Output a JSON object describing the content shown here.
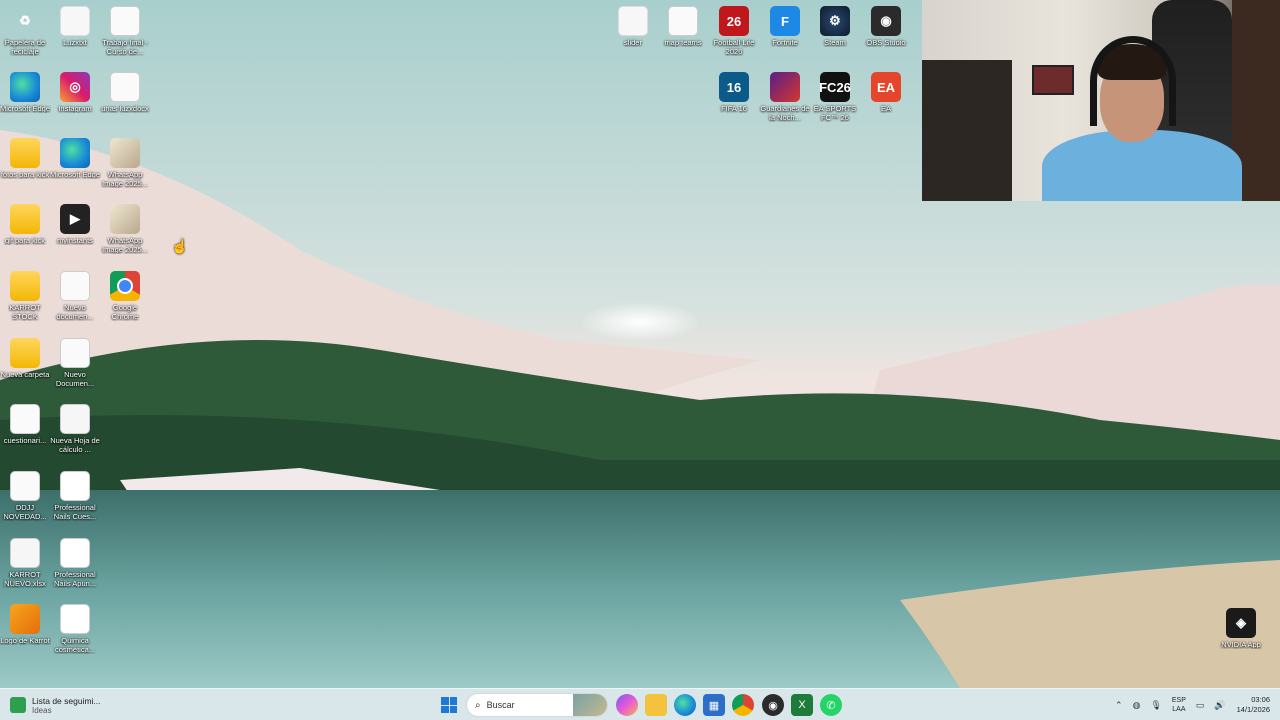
{
  "desktop_icons_left": [
    {
      "label": "Papelera de reciclaje",
      "icon": "recycle-bin-icon"
    },
    {
      "label": "Luzxtxt",
      "icon": "text-file-icon"
    },
    {
      "label": "Trabajo final - Curso de...",
      "icon": "document-icon"
    },
    {
      "label": "Microsoft Edge",
      "icon": "edge-icon"
    },
    {
      "label": "Instagram",
      "icon": "instagram-icon"
    },
    {
      "label": "unas luzxdocx",
      "icon": "document-icon"
    },
    {
      "label": "fotos para kick",
      "icon": "folder-icon"
    },
    {
      "label": "Microsoft Edge",
      "icon": "edge-icon"
    },
    {
      "label": "WhatsApp Image 2025...",
      "icon": "image-icon"
    },
    {
      "label": "gif para kick",
      "icon": "folder-icon"
    },
    {
      "label": "myinstants",
      "icon": "media-icon"
    },
    {
      "label": "WhatsApp Image 2025...",
      "icon": "image-icon"
    },
    {
      "label": "KARROT STOCK",
      "icon": "folder-icon"
    },
    {
      "label": "Nuevo documen...",
      "icon": "document-icon"
    },
    {
      "label": "Google Chrome",
      "icon": "chrome-icon"
    },
    {
      "label": "Nueva carpeta",
      "icon": "folder-icon"
    },
    {
      "label": "Nuevo Documen...",
      "icon": "document-icon"
    },
    {
      "label": "cuestionari...",
      "icon": "document-icon"
    },
    {
      "label": "Nueva Hoja de cálculo ...",
      "icon": "spreadsheet-icon"
    },
    {
      "label": "DDJJ NOVEDAD...",
      "icon": "document-icon"
    },
    {
      "label": "Professional Nails Cues...",
      "icon": "pdf-icon"
    },
    {
      "label": "KARROT NUEVO.xlsx",
      "icon": "spreadsheet-icon"
    },
    {
      "label": "Professional Nails Apun...",
      "icon": "pdf-icon"
    },
    {
      "label": "Logo de Karrot",
      "icon": "image-icon"
    },
    {
      "label": "Quimica cosmética...",
      "icon": "pdf-icon"
    }
  ],
  "desktop_icons_top": [
    {
      "label": "slider",
      "icon": "file-icon"
    },
    {
      "label": "map teams",
      "icon": "document-icon"
    },
    {
      "label": "Football Life 2026",
      "icon": "game-icon",
      "glyph": "26"
    },
    {
      "label": "Fortnite",
      "icon": "fortnite-icon",
      "glyph": "F"
    },
    {
      "label": "Steam",
      "icon": "steam-icon"
    },
    {
      "label": "OBS Studio",
      "icon": "obs-icon"
    },
    {
      "label": "FIFA 16",
      "icon": "fifa-icon",
      "glyph": "16"
    },
    {
      "label": "Guardianes de la Noch...",
      "icon": "game-icon"
    },
    {
      "label": "EA SPORTS FC™ 26",
      "icon": "fc-icon",
      "glyph": "FC26"
    },
    {
      "label": "EA",
      "icon": "ea-icon",
      "glyph": "EA"
    }
  ],
  "nvidia": {
    "label": "NVIDIA App"
  },
  "taskbar": {
    "widget_title": "Lista de seguimi...",
    "widget_sub": "Ideas",
    "search_placeholder": "Buscar",
    "lang_1": "ESP",
    "lang_2": "LAA",
    "time": "03:06",
    "date": "14/1/2026"
  }
}
